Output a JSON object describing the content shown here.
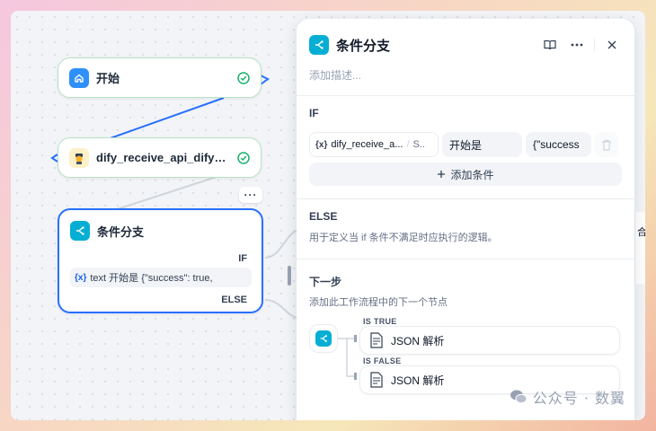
{
  "canvas": {
    "start_node": {
      "title": "开始",
      "icon": "home-icon",
      "status": "success"
    },
    "api_node": {
      "title": "dify_receive_api_dify_re...",
      "icon": "bot-avatar-icon",
      "status": "success"
    },
    "more_label": "···",
    "if_node": {
      "title": "条件分支",
      "icon": "branch-icon",
      "if_label": "IF",
      "condition_badge": "{x}",
      "condition_text": "text 开始是 {\"success\": true,",
      "else_label": "ELSE"
    },
    "right_sliver_text": "合"
  },
  "panel": {
    "title": "条件分支",
    "description_placeholder": "添加描述...",
    "if_section": {
      "title": "IF",
      "condition": {
        "var_badge": "{x}",
        "variable": "dify_receive_a...",
        "separator": "/",
        "variable_type": "S..",
        "operator": "开始是",
        "value": "{\"success"
      },
      "add_condition_label": "添加条件",
      "add_condition_icon": "plus-icon"
    },
    "else_section": {
      "title": "ELSE",
      "description": "用于定义当 if 条件不满足时应执行的逻辑。"
    },
    "next_step": {
      "title": "下一步",
      "description": "添加此工作流程中的下一个节点",
      "branches": [
        {
          "tag": "IS TRUE",
          "target": "JSON 解析",
          "icon": "json-parse-icon"
        },
        {
          "tag": "IS FALSE",
          "target": "JSON 解析",
          "icon": "json-parse-icon"
        }
      ]
    }
  },
  "watermark": {
    "text": "公众号 · 数翼",
    "icon": "wechat-icon"
  },
  "colors": {
    "accent": "#2970ff",
    "branch_icon_bg": "#06aed4",
    "success": "#17b26a",
    "start_icon_bg": "#2e90fa"
  }
}
